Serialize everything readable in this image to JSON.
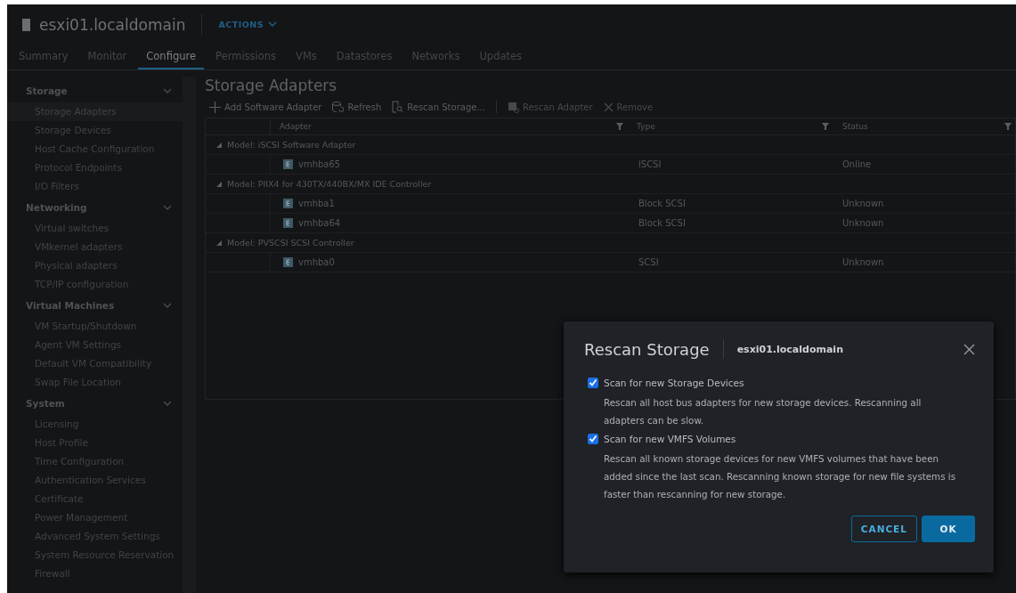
{
  "header": {
    "title": "esxi01.localdomain",
    "actions": "ACTIONS"
  },
  "tabs": [
    {
      "label": "Summary",
      "selected": false
    },
    {
      "label": "Monitor",
      "selected": false
    },
    {
      "label": "Configure",
      "selected": true
    },
    {
      "label": "Permissions",
      "selected": false
    },
    {
      "label": "VMs",
      "selected": false
    },
    {
      "label": "Datastores",
      "selected": false
    },
    {
      "label": "Networks",
      "selected": false
    },
    {
      "label": "Updates",
      "selected": false
    }
  ],
  "sidebar": [
    {
      "label": "Storage",
      "expanded": true,
      "children": [
        {
          "label": "Storage Adapters",
          "selected": true
        },
        {
          "label": "Storage Devices",
          "selected": false
        },
        {
          "label": "Host Cache Configuration",
          "selected": false
        },
        {
          "label": "Protocol Endpoints",
          "selected": false
        },
        {
          "label": "I/O Filters",
          "selected": false
        }
      ]
    },
    {
      "label": "Networking",
      "expanded": true,
      "children": [
        {
          "label": "Virtual switches",
          "selected": false
        },
        {
          "label": "VMkernel adapters",
          "selected": false
        },
        {
          "label": "Physical adapters",
          "selected": false
        },
        {
          "label": "TCP/IP configuration",
          "selected": false
        }
      ]
    },
    {
      "label": "Virtual Machines",
      "expanded": true,
      "children": [
        {
          "label": "VM Startup/Shutdown",
          "selected": false
        },
        {
          "label": "Agent VM Settings",
          "selected": false
        },
        {
          "label": "Default VM Compatibility",
          "selected": false
        },
        {
          "label": "Swap File Location",
          "selected": false
        }
      ]
    },
    {
      "label": "System",
      "expanded": true,
      "children": [
        {
          "label": "Licensing",
          "selected": false
        },
        {
          "label": "Host Profile",
          "selected": false
        },
        {
          "label": "Time Configuration",
          "selected": false
        },
        {
          "label": "Authentication Services",
          "selected": false
        },
        {
          "label": "Certificate",
          "selected": false
        },
        {
          "label": "Power Management",
          "selected": false
        },
        {
          "label": "Advanced System Settings",
          "selected": false
        },
        {
          "label": "System Resource Reservation",
          "selected": false
        },
        {
          "label": "Firewall",
          "selected": false
        }
      ]
    }
  ],
  "page_title": "Storage Adapters",
  "toolbar": [
    {
      "kind": "add",
      "label": "Add Software Adapter",
      "disabled": false
    },
    {
      "kind": "refresh",
      "label": "Refresh",
      "disabled": false
    },
    {
      "kind": "rescan",
      "label": "Rescan Storage...",
      "disabled": false
    },
    {
      "kind": "separator"
    },
    {
      "kind": "rescan-adapter",
      "label": "Rescan Adapter",
      "disabled": true
    },
    {
      "kind": "remove",
      "label": "Remove",
      "disabled": true
    }
  ],
  "table": {
    "columns": [
      "Adapter",
      "Type",
      "Status"
    ],
    "groups": [
      {
        "label": "Model: iSCSI Software Adapter",
        "expanded": true,
        "rows": [
          {
            "adapter": "vmhba65",
            "type": "iSCSI",
            "status": "Online"
          }
        ]
      },
      {
        "label": "Model: PIIX4 for 430TX/440BX/MX IDE Controller",
        "expanded": true,
        "rows": [
          {
            "adapter": "vmhba1",
            "type": "Block SCSI",
            "status": "Unknown"
          },
          {
            "adapter": "vmhba64",
            "type": "Block SCSI",
            "status": "Unknown"
          }
        ]
      },
      {
        "label": "Model: PVSCSI SCSI Controller",
        "expanded": true,
        "rows": [
          {
            "adapter": "vmhba0",
            "type": "SCSI",
            "status": "Unknown"
          }
        ]
      }
    ]
  },
  "dialog": {
    "title": "Rescan Storage",
    "subtitle": "esxi01.localdomain",
    "options": [
      {
        "label": "Scan for new Storage Devices",
        "checked": true,
        "description": "Rescan all host bus adapters for new storage devices. Rescanning all adapters can be slow."
      },
      {
        "label": "Scan for new VMFS Volumes",
        "checked": true,
        "description": "Rescan all known storage devices for new VMFS volumes that have been added since the last scan. Rescanning known storage for new file systems is faster than rescanning for new storage."
      }
    ],
    "buttons": [
      {
        "label": "CANCEL",
        "kind": "secondary"
      },
      {
        "label": "OK",
        "kind": "primary"
      }
    ]
  }
}
